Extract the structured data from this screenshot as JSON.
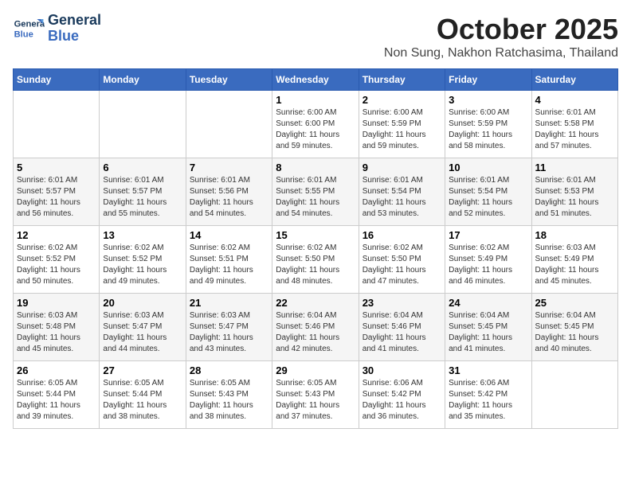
{
  "header": {
    "logo_line1": "General",
    "logo_line2": "Blue",
    "month": "October 2025",
    "location": "Non Sung, Nakhon Ratchasima, Thailand"
  },
  "weekdays": [
    "Sunday",
    "Monday",
    "Tuesday",
    "Wednesday",
    "Thursday",
    "Friday",
    "Saturday"
  ],
  "weeks": [
    [
      {
        "day": "",
        "info": ""
      },
      {
        "day": "",
        "info": ""
      },
      {
        "day": "",
        "info": ""
      },
      {
        "day": "1",
        "info": "Sunrise: 6:00 AM\nSunset: 6:00 PM\nDaylight: 11 hours\nand 59 minutes."
      },
      {
        "day": "2",
        "info": "Sunrise: 6:00 AM\nSunset: 5:59 PM\nDaylight: 11 hours\nand 59 minutes."
      },
      {
        "day": "3",
        "info": "Sunrise: 6:00 AM\nSunset: 5:59 PM\nDaylight: 11 hours\nand 58 minutes."
      },
      {
        "day": "4",
        "info": "Sunrise: 6:01 AM\nSunset: 5:58 PM\nDaylight: 11 hours\nand 57 minutes."
      }
    ],
    [
      {
        "day": "5",
        "info": "Sunrise: 6:01 AM\nSunset: 5:57 PM\nDaylight: 11 hours\nand 56 minutes."
      },
      {
        "day": "6",
        "info": "Sunrise: 6:01 AM\nSunset: 5:57 PM\nDaylight: 11 hours\nand 55 minutes."
      },
      {
        "day": "7",
        "info": "Sunrise: 6:01 AM\nSunset: 5:56 PM\nDaylight: 11 hours\nand 54 minutes."
      },
      {
        "day": "8",
        "info": "Sunrise: 6:01 AM\nSunset: 5:55 PM\nDaylight: 11 hours\nand 54 minutes."
      },
      {
        "day": "9",
        "info": "Sunrise: 6:01 AM\nSunset: 5:54 PM\nDaylight: 11 hours\nand 53 minutes."
      },
      {
        "day": "10",
        "info": "Sunrise: 6:01 AM\nSunset: 5:54 PM\nDaylight: 11 hours\nand 52 minutes."
      },
      {
        "day": "11",
        "info": "Sunrise: 6:01 AM\nSunset: 5:53 PM\nDaylight: 11 hours\nand 51 minutes."
      }
    ],
    [
      {
        "day": "12",
        "info": "Sunrise: 6:02 AM\nSunset: 5:52 PM\nDaylight: 11 hours\nand 50 minutes."
      },
      {
        "day": "13",
        "info": "Sunrise: 6:02 AM\nSunset: 5:52 PM\nDaylight: 11 hours\nand 49 minutes."
      },
      {
        "day": "14",
        "info": "Sunrise: 6:02 AM\nSunset: 5:51 PM\nDaylight: 11 hours\nand 49 minutes."
      },
      {
        "day": "15",
        "info": "Sunrise: 6:02 AM\nSunset: 5:50 PM\nDaylight: 11 hours\nand 48 minutes."
      },
      {
        "day": "16",
        "info": "Sunrise: 6:02 AM\nSunset: 5:50 PM\nDaylight: 11 hours\nand 47 minutes."
      },
      {
        "day": "17",
        "info": "Sunrise: 6:02 AM\nSunset: 5:49 PM\nDaylight: 11 hours\nand 46 minutes."
      },
      {
        "day": "18",
        "info": "Sunrise: 6:03 AM\nSunset: 5:49 PM\nDaylight: 11 hours\nand 45 minutes."
      }
    ],
    [
      {
        "day": "19",
        "info": "Sunrise: 6:03 AM\nSunset: 5:48 PM\nDaylight: 11 hours\nand 45 minutes."
      },
      {
        "day": "20",
        "info": "Sunrise: 6:03 AM\nSunset: 5:47 PM\nDaylight: 11 hours\nand 44 minutes."
      },
      {
        "day": "21",
        "info": "Sunrise: 6:03 AM\nSunset: 5:47 PM\nDaylight: 11 hours\nand 43 minutes."
      },
      {
        "day": "22",
        "info": "Sunrise: 6:04 AM\nSunset: 5:46 PM\nDaylight: 11 hours\nand 42 minutes."
      },
      {
        "day": "23",
        "info": "Sunrise: 6:04 AM\nSunset: 5:46 PM\nDaylight: 11 hours\nand 41 minutes."
      },
      {
        "day": "24",
        "info": "Sunrise: 6:04 AM\nSunset: 5:45 PM\nDaylight: 11 hours\nand 41 minutes."
      },
      {
        "day": "25",
        "info": "Sunrise: 6:04 AM\nSunset: 5:45 PM\nDaylight: 11 hours\nand 40 minutes."
      }
    ],
    [
      {
        "day": "26",
        "info": "Sunrise: 6:05 AM\nSunset: 5:44 PM\nDaylight: 11 hours\nand 39 minutes."
      },
      {
        "day": "27",
        "info": "Sunrise: 6:05 AM\nSunset: 5:44 PM\nDaylight: 11 hours\nand 38 minutes."
      },
      {
        "day": "28",
        "info": "Sunrise: 6:05 AM\nSunset: 5:43 PM\nDaylight: 11 hours\nand 38 minutes."
      },
      {
        "day": "29",
        "info": "Sunrise: 6:05 AM\nSunset: 5:43 PM\nDaylight: 11 hours\nand 37 minutes."
      },
      {
        "day": "30",
        "info": "Sunrise: 6:06 AM\nSunset: 5:42 PM\nDaylight: 11 hours\nand 36 minutes."
      },
      {
        "day": "31",
        "info": "Sunrise: 6:06 AM\nSunset: 5:42 PM\nDaylight: 11 hours\nand 35 minutes."
      },
      {
        "day": "",
        "info": ""
      }
    ]
  ]
}
